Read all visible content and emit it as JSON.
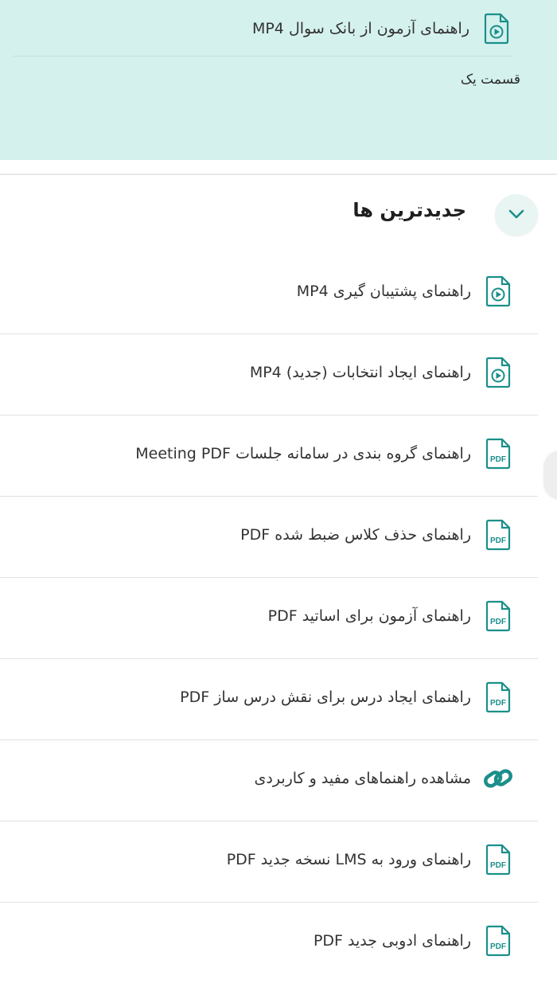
{
  "top_panel": {
    "item_label": "راهنمای آزمون از بانک سوال  MP4",
    "item_icon": "video-file-icon",
    "subtitle": "قسمت یک"
  },
  "section": {
    "title": "جدیدترین ها",
    "toggle_icon": "chevron-down-icon"
  },
  "items": [
    {
      "label": "راهنمای پشتیبان گیری  MP4",
      "icon": "video-file-icon"
    },
    {
      "label": "راهنمای ایجاد انتخابات (جدید)  MP4",
      "icon": "video-file-icon"
    },
    {
      "label": "راهنمای گروه بندی در سامانه جلسات Meeting  PDF",
      "icon": "pdf-file-icon"
    },
    {
      "label": "راهنمای حذف کلاس ضبط شده  PDF",
      "icon": "pdf-file-icon"
    },
    {
      "label": "راهنمای آزمون برای اساتید  PDF",
      "icon": "pdf-file-icon"
    },
    {
      "label": "راهنمای ایجاد درس برای نقش درس ساز  PDF",
      "icon": "pdf-file-icon"
    },
    {
      "label": "مشاهده راهنماهای مفید و کاربردی",
      "icon": "link-icon"
    },
    {
      "label": "راهنمای ورود به LMS نسخه جدید  PDF",
      "icon": "pdf-file-icon"
    },
    {
      "label": "راهنمای ادوبی جدید  PDF",
      "icon": "pdf-file-icon"
    }
  ],
  "colors": {
    "accent": "#1b8f8a",
    "panel_bg": "#d4f1ed"
  }
}
